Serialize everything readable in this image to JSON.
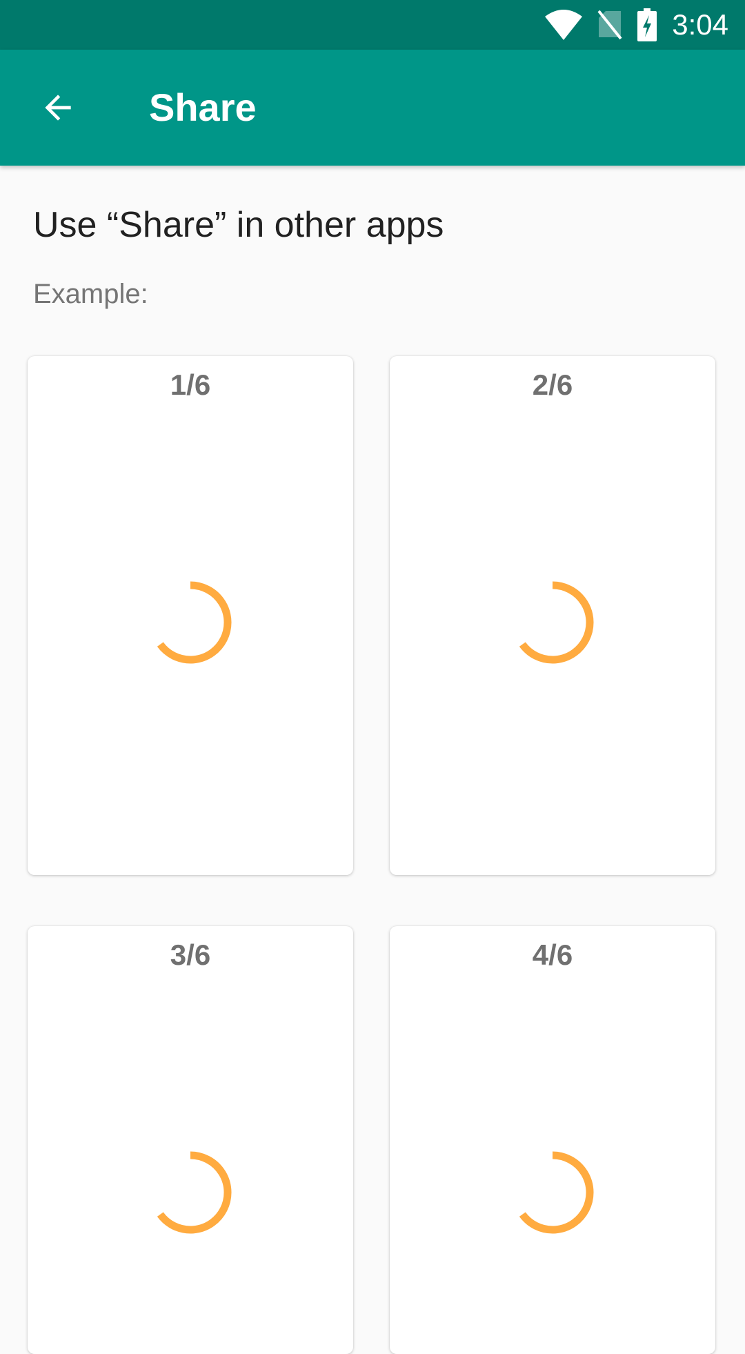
{
  "status_bar": {
    "time": "3:04",
    "icons": [
      "wifi-icon",
      "no-sim-icon",
      "battery-charging-icon"
    ]
  },
  "app_bar": {
    "title": "Share",
    "back_icon": "arrow-back-icon"
  },
  "content": {
    "heading": "Use “Share” in other apps",
    "subheading": "Example:",
    "cards": [
      {
        "label": "1/6",
        "icon": "loading-spinner-icon"
      },
      {
        "label": "2/6",
        "icon": "loading-spinner-icon"
      },
      {
        "label": "3/6",
        "icon": "loading-spinner-icon"
      },
      {
        "label": "4/6",
        "icon": "loading-spinner-icon"
      }
    ]
  },
  "colors": {
    "status_bar": "#00796b",
    "app_bar": "#009688",
    "spinner": "#ffab40",
    "background": "#fafafa"
  }
}
